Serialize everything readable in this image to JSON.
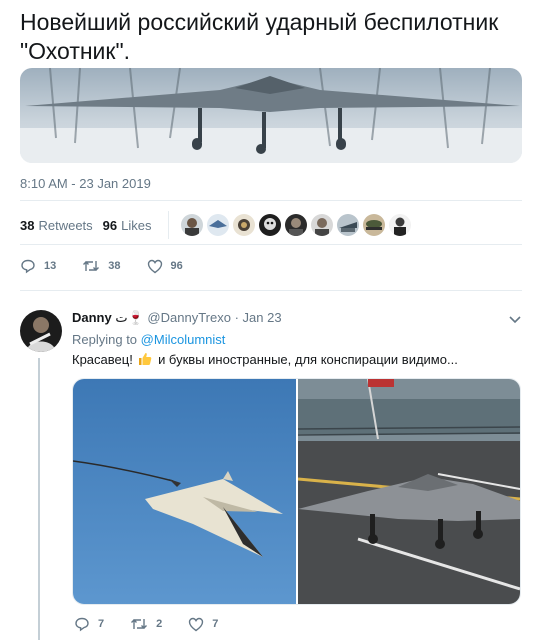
{
  "tweet": {
    "text": "Новейший российский ударный беспилотник \"Охотник\".",
    "timestamp": "8:10 AM - 23 Jan 2019",
    "retweets_count": "38",
    "retweets_label": "Retweets",
    "likes_count": "96",
    "likes_label": "Likes",
    "actions": {
      "replies": "13",
      "retweets": "38",
      "likes": "96"
    }
  },
  "reply": {
    "display_name": "Danny",
    "name_suffix": "ت🍷",
    "handle": "@DannyTrexo",
    "date": "· Jan 23",
    "replying_to_label": "Replying to",
    "replying_to_handle": "@Milcolumnist",
    "text_before": "Красавец!",
    "text_after": "и буквы иностранные, для конспирации видимо...",
    "actions": {
      "replies": "7",
      "retweets": "2",
      "likes": "7"
    }
  },
  "colors": {
    "accent": "#1b95e0",
    "muted": "#657786",
    "text": "#14171a",
    "divider": "#e6ecf0"
  },
  "icons": [
    "reply-icon",
    "retweet-icon",
    "heart-icon",
    "chevron-down-icon",
    "thumbs-up-emoji"
  ]
}
